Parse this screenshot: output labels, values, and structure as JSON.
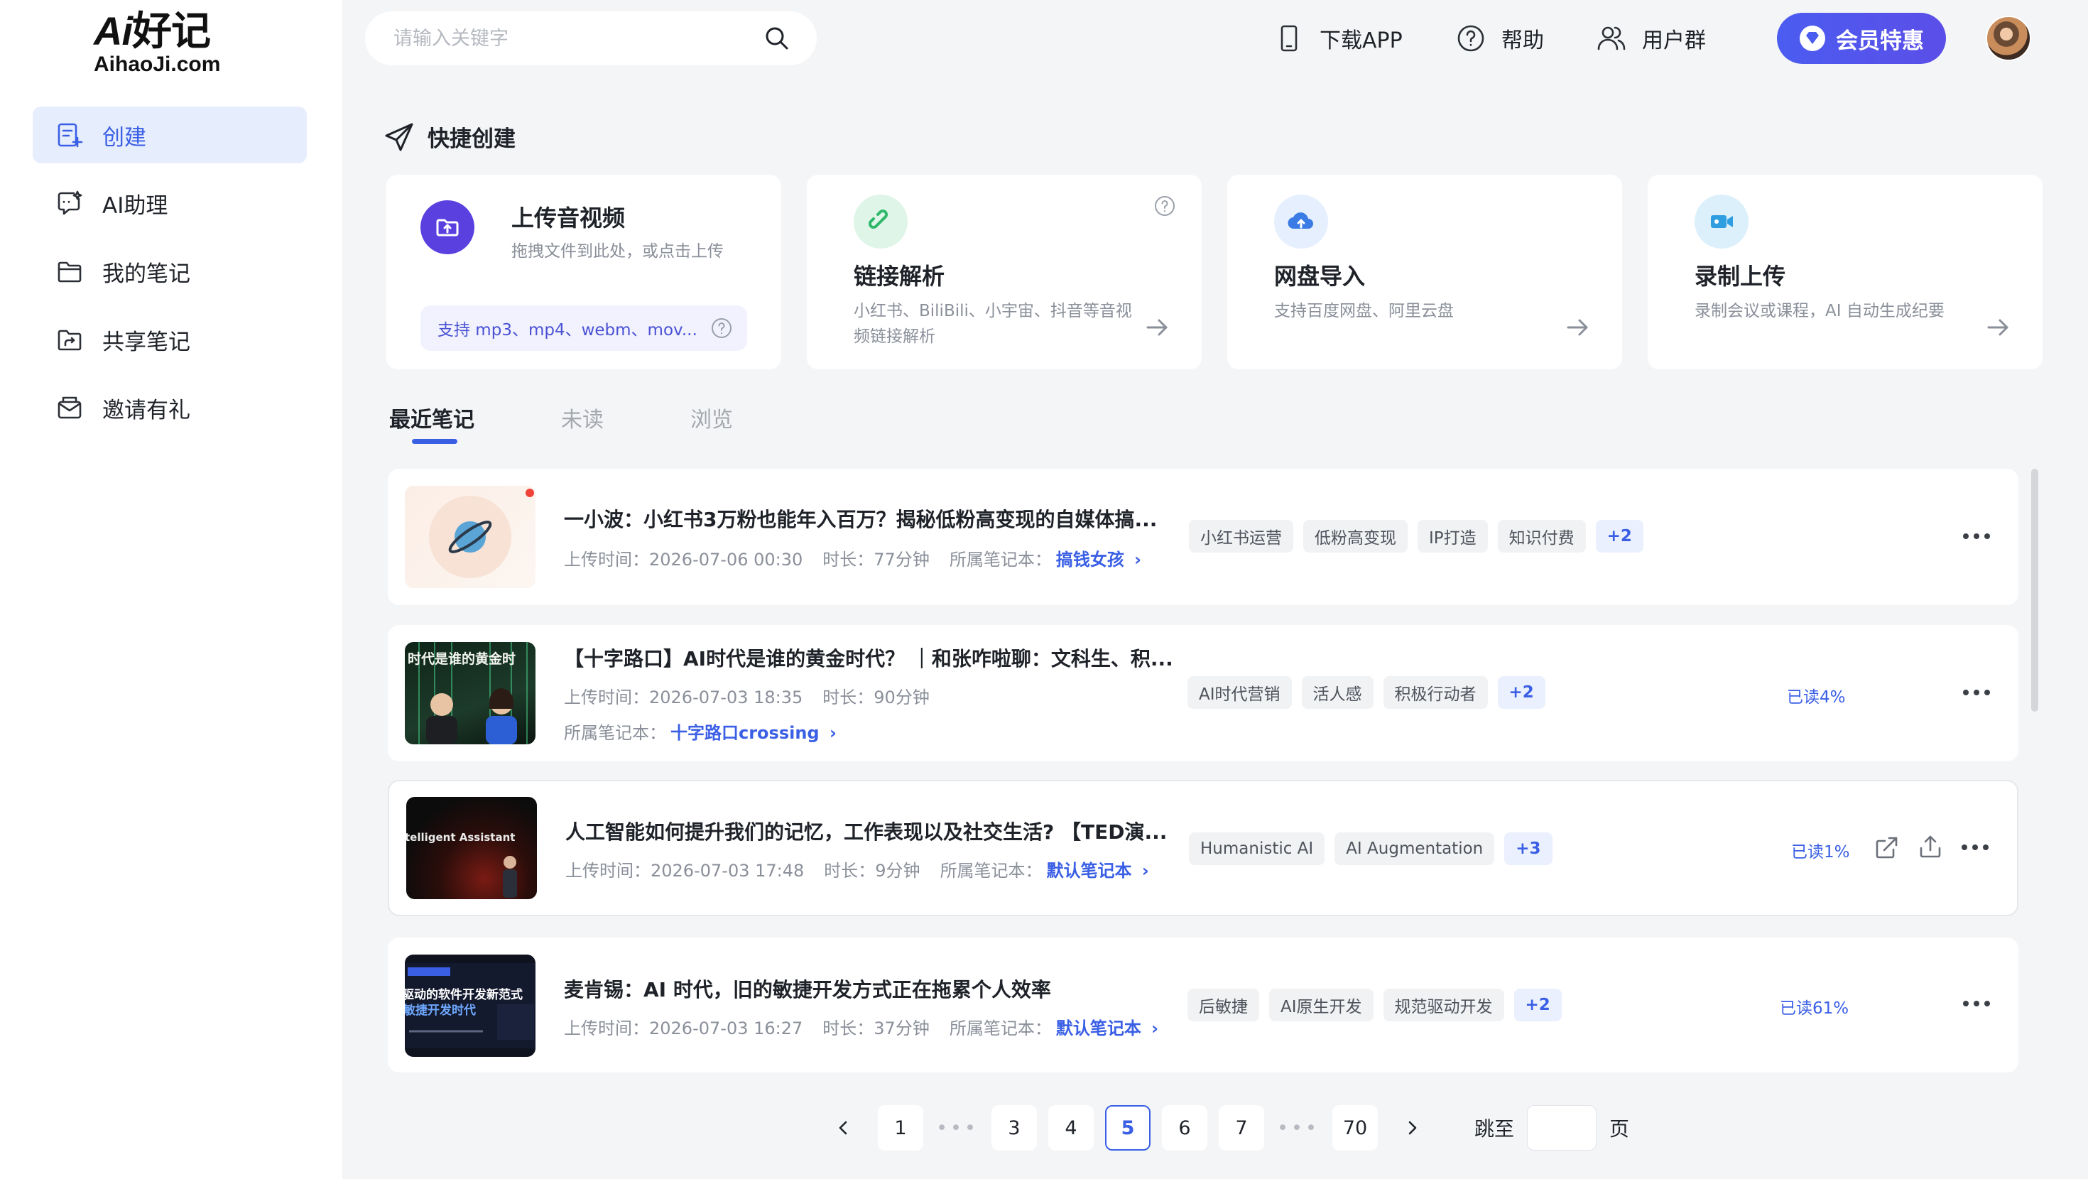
{
  "logo": {
    "main_ai": "Ai",
    "main_cn": "好记",
    "sub": "AihaoJi.com"
  },
  "sidebar": {
    "items": [
      {
        "label": "创建",
        "icon": "create-icon",
        "active": true
      },
      {
        "label": "AI助理",
        "icon": "ai-chat-icon"
      },
      {
        "label": "我的笔记",
        "icon": "folder-icon"
      },
      {
        "label": "共享笔记",
        "icon": "share-folder-icon"
      },
      {
        "label": "邀请有礼",
        "icon": "invite-mail-icon"
      }
    ]
  },
  "header": {
    "search_placeholder": "请输入关键字",
    "download": "下载APP",
    "help": "帮助",
    "user_group": "用户群",
    "vip": "会员特惠"
  },
  "quick_create": {
    "title": "快捷创建",
    "cards": [
      {
        "title": "上传音视频",
        "desc": "拖拽文件到此处，或点击上传",
        "support": "支持 mp3、mp4、webm、mov..."
      },
      {
        "title": "链接解析",
        "desc1": "小红书、BiliBili、小宇宙、抖音等音视",
        "desc2": "频链接解析"
      },
      {
        "title": "网盘导入",
        "desc": "支持百度网盘、阿里云盘"
      },
      {
        "title": "录制上传",
        "desc": "录制会议或课程，AI 自动生成纪要"
      }
    ]
  },
  "tabs": [
    "最近笔记",
    "未读",
    "浏览"
  ],
  "labels": {
    "upload_time": "上传时间：",
    "duration": "时长：",
    "notebook": "所属笔记本："
  },
  "notes": [
    {
      "title": "一小波：小红书3万粉也能年入百万？揭秘低粉高变现的自媒体搞...",
      "time": "2026-07-06 00:30",
      "duration": "77分钟",
      "notebook": "搞钱女孩",
      "tags": [
        "小红书运营",
        "低粉高变现",
        "IP打造",
        "知识付费"
      ],
      "more": "+2",
      "read": ""
    },
    {
      "title": "【十字路口】AI时代是谁的黄金时代？ ｜和张咋啦聊：文科生、积...",
      "time": "2026-07-03 18:35",
      "duration": "90分钟",
      "notebook": "十字路口crossing",
      "tags": [
        "AI时代营销",
        "活人感",
        "积极行动者"
      ],
      "more": "+2",
      "read": "已读4%"
    },
    {
      "title": "人工智能如何提升我们的记忆，工作表现以及社交生活? 【TED演...",
      "time": "2026-07-03 17:48",
      "duration": "9分钟",
      "notebook": "默认笔记本",
      "tags": [
        "Humanistic AI",
        "AI Augmentation"
      ],
      "more": "+3",
      "read": "已读1%"
    },
    {
      "title": "麦肯锡：AI 时代，旧的敏捷开发方式正在拖累个人效率",
      "time": "2026-07-03 16:27",
      "duration": "37分钟",
      "notebook": "默认笔记本",
      "tags": [
        "后敏捷",
        "AI原生开发",
        "规范驱动开发"
      ],
      "more": "+2",
      "read": "已读61%"
    }
  ],
  "thumb_text": {
    "note2": "时代是谁的黄金时",
    "note3": "telligent Assistant",
    "note4_a": "驱动的软件开发新范式",
    "note4_b": "敏捷开发时代"
  },
  "pagination": {
    "pages": [
      "1",
      "3",
      "4",
      "5",
      "6",
      "7",
      "70"
    ],
    "ellipsis": "•••",
    "current": "5",
    "jump_label": "跳至",
    "page_label": "页"
  },
  "colors": {
    "accent": "#3a5fe5",
    "vip": "#4b5cf0",
    "active_nav_bg": "#e6edfd"
  }
}
